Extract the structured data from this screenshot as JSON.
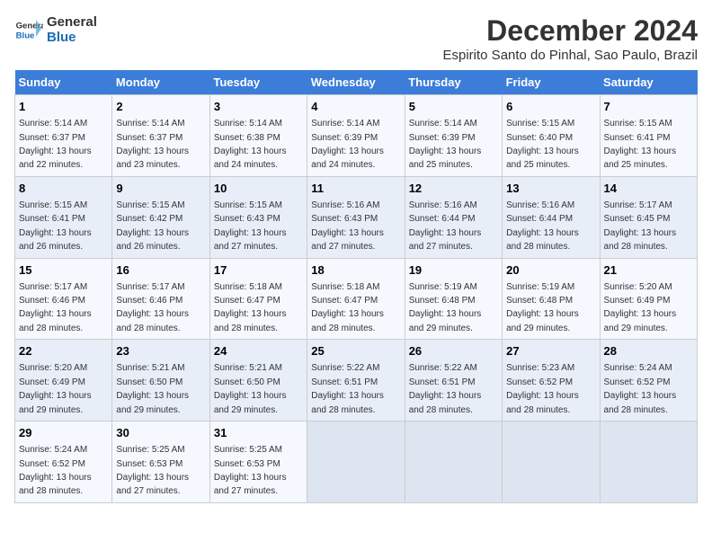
{
  "logo": {
    "line1": "General",
    "line2": "Blue"
  },
  "title": "December 2024",
  "subtitle": "Espirito Santo do Pinhal, Sao Paulo, Brazil",
  "days_header": [
    "Sunday",
    "Monday",
    "Tuesday",
    "Wednesday",
    "Thursday",
    "Friday",
    "Saturday"
  ],
  "weeks": [
    [
      {
        "day": "1",
        "sunrise": "5:14 AM",
        "sunset": "6:37 PM",
        "daylight": "13 hours and 22 minutes."
      },
      {
        "day": "2",
        "sunrise": "5:14 AM",
        "sunset": "6:37 PM",
        "daylight": "13 hours and 23 minutes."
      },
      {
        "day": "3",
        "sunrise": "5:14 AM",
        "sunset": "6:38 PM",
        "daylight": "13 hours and 24 minutes."
      },
      {
        "day": "4",
        "sunrise": "5:14 AM",
        "sunset": "6:39 PM",
        "daylight": "13 hours and 24 minutes."
      },
      {
        "day": "5",
        "sunrise": "5:14 AM",
        "sunset": "6:39 PM",
        "daylight": "13 hours and 25 minutes."
      },
      {
        "day": "6",
        "sunrise": "5:15 AM",
        "sunset": "6:40 PM",
        "daylight": "13 hours and 25 minutes."
      },
      {
        "day": "7",
        "sunrise": "5:15 AM",
        "sunset": "6:41 PM",
        "daylight": "13 hours and 25 minutes."
      }
    ],
    [
      {
        "day": "8",
        "sunrise": "5:15 AM",
        "sunset": "6:41 PM",
        "daylight": "13 hours and 26 minutes."
      },
      {
        "day": "9",
        "sunrise": "5:15 AM",
        "sunset": "6:42 PM",
        "daylight": "13 hours and 26 minutes."
      },
      {
        "day": "10",
        "sunrise": "5:15 AM",
        "sunset": "6:43 PM",
        "daylight": "13 hours and 27 minutes."
      },
      {
        "day": "11",
        "sunrise": "5:16 AM",
        "sunset": "6:43 PM",
        "daylight": "13 hours and 27 minutes."
      },
      {
        "day": "12",
        "sunrise": "5:16 AM",
        "sunset": "6:44 PM",
        "daylight": "13 hours and 27 minutes."
      },
      {
        "day": "13",
        "sunrise": "5:16 AM",
        "sunset": "6:44 PM",
        "daylight": "13 hours and 28 minutes."
      },
      {
        "day": "14",
        "sunrise": "5:17 AM",
        "sunset": "6:45 PM",
        "daylight": "13 hours and 28 minutes."
      }
    ],
    [
      {
        "day": "15",
        "sunrise": "5:17 AM",
        "sunset": "6:46 PM",
        "daylight": "13 hours and 28 minutes."
      },
      {
        "day": "16",
        "sunrise": "5:17 AM",
        "sunset": "6:46 PM",
        "daylight": "13 hours and 28 minutes."
      },
      {
        "day": "17",
        "sunrise": "5:18 AM",
        "sunset": "6:47 PM",
        "daylight": "13 hours and 28 minutes."
      },
      {
        "day": "18",
        "sunrise": "5:18 AM",
        "sunset": "6:47 PM",
        "daylight": "13 hours and 28 minutes."
      },
      {
        "day": "19",
        "sunrise": "5:19 AM",
        "sunset": "6:48 PM",
        "daylight": "13 hours and 29 minutes."
      },
      {
        "day": "20",
        "sunrise": "5:19 AM",
        "sunset": "6:48 PM",
        "daylight": "13 hours and 29 minutes."
      },
      {
        "day": "21",
        "sunrise": "5:20 AM",
        "sunset": "6:49 PM",
        "daylight": "13 hours and 29 minutes."
      }
    ],
    [
      {
        "day": "22",
        "sunrise": "5:20 AM",
        "sunset": "6:49 PM",
        "daylight": "13 hours and 29 minutes."
      },
      {
        "day": "23",
        "sunrise": "5:21 AM",
        "sunset": "6:50 PM",
        "daylight": "13 hours and 29 minutes."
      },
      {
        "day": "24",
        "sunrise": "5:21 AM",
        "sunset": "6:50 PM",
        "daylight": "13 hours and 29 minutes."
      },
      {
        "day": "25",
        "sunrise": "5:22 AM",
        "sunset": "6:51 PM",
        "daylight": "13 hours and 28 minutes."
      },
      {
        "day": "26",
        "sunrise": "5:22 AM",
        "sunset": "6:51 PM",
        "daylight": "13 hours and 28 minutes."
      },
      {
        "day": "27",
        "sunrise": "5:23 AM",
        "sunset": "6:52 PM",
        "daylight": "13 hours and 28 minutes."
      },
      {
        "day": "28",
        "sunrise": "5:24 AM",
        "sunset": "6:52 PM",
        "daylight": "13 hours and 28 minutes."
      }
    ],
    [
      {
        "day": "29",
        "sunrise": "5:24 AM",
        "sunset": "6:52 PM",
        "daylight": "13 hours and 28 minutes."
      },
      {
        "day": "30",
        "sunrise": "5:25 AM",
        "sunset": "6:53 PM",
        "daylight": "13 hours and 27 minutes."
      },
      {
        "day": "31",
        "sunrise": "5:25 AM",
        "sunset": "6:53 PM",
        "daylight": "13 hours and 27 minutes."
      },
      null,
      null,
      null,
      null
    ]
  ]
}
